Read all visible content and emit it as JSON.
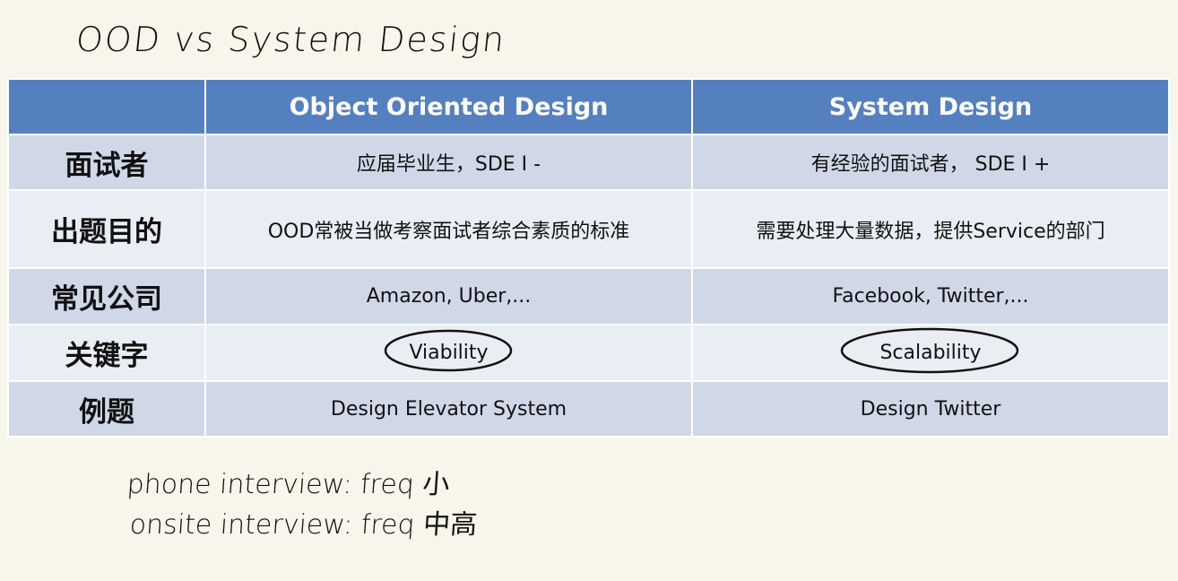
{
  "handwritten": {
    "title": "OOD vs System Design",
    "notes": [
      "phone interview: freq 小",
      "onsite interview: freq 中高"
    ]
  },
  "table": {
    "columns": [
      "",
      "Object Oriented Design",
      "System Design"
    ],
    "rows": [
      {
        "label": "面试者",
        "ood": "应届毕业生，SDE I -",
        "sd": "有经验的面试者， SDE I +"
      },
      {
        "label": "出题目的",
        "ood": "OOD常被当做考察面试者综合素质的标准",
        "sd": "需要处理大量数据，提供Service的部门"
      },
      {
        "label": "常见公司",
        "ood": "Amazon, Uber,...",
        "sd": "Facebook, Twitter,..."
      },
      {
        "label": "关键字",
        "ood": "Viability",
        "sd": "Scalability"
      },
      {
        "label": "例题",
        "ood": "Design Elevator System",
        "sd": "Design Twitter"
      }
    ]
  },
  "colors": {
    "header": "#5580bf",
    "row_dark": "#d0d8e8",
    "row_light": "#e9edf4",
    "background": "#f8f6eb"
  }
}
